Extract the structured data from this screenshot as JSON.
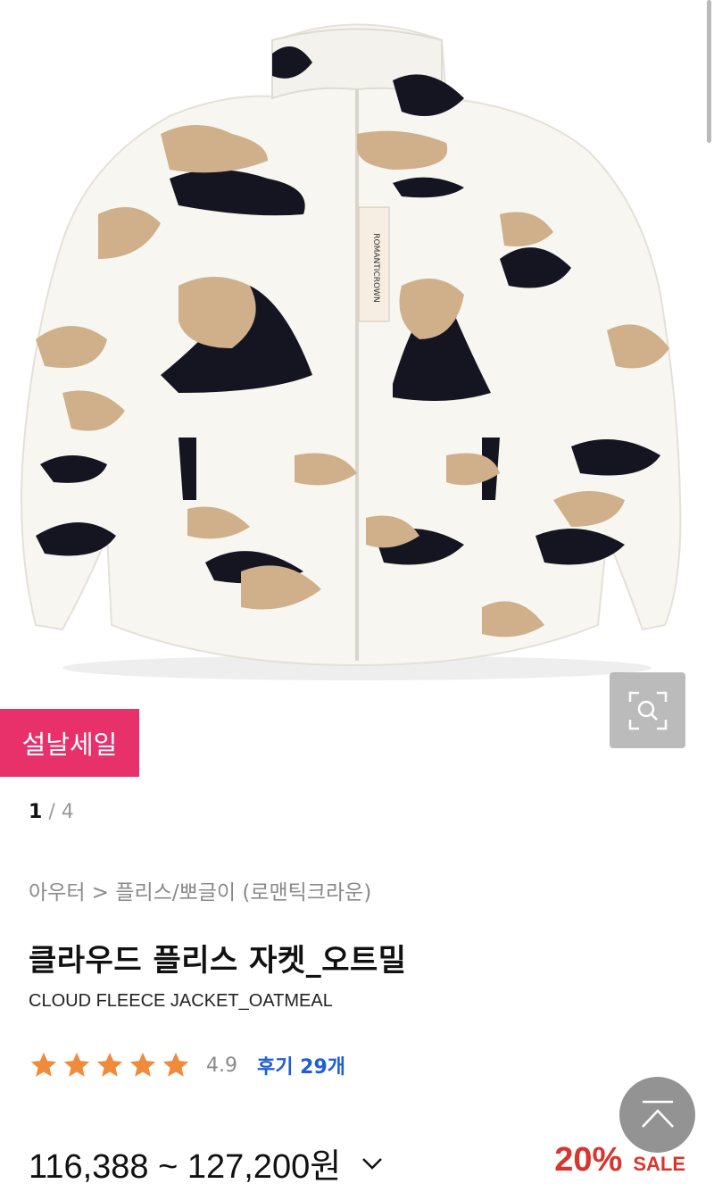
{
  "product_image": {
    "label_tag_text": "ROMANTICROWN"
  },
  "promo_badge": "설날세일",
  "gallery": {
    "current": "1",
    "separator": "/",
    "total": "4"
  },
  "breadcrumb": "아우터 > 플리스/뽀글이 (로맨틱크라운)",
  "product": {
    "name_ko": "클라우드 플리스 자켓_오트밀",
    "name_en": "CLOUD FLEECE JACKET_OATMEAL",
    "rating": "4.9",
    "stars": 5,
    "review_label": "후기 29개",
    "price_range": "116,388 ~ 127,200원",
    "discount_percent": "20%",
    "sale_label": "SALE"
  },
  "colors": {
    "promo": "#e8306b",
    "star": "#f08a3c",
    "link": "#1f5fd0",
    "discount": "#d8352f"
  },
  "icons": [
    "zoom-icon",
    "star-icon",
    "chevron-down-icon",
    "scroll-top-icon"
  ]
}
